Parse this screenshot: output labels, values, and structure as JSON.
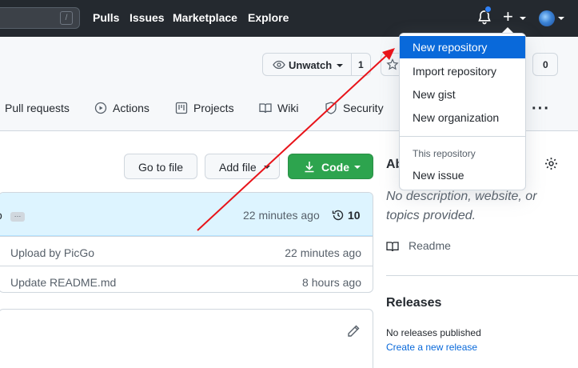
{
  "header": {
    "search_shortcut": "/",
    "nav": [
      "Pulls",
      "Issues",
      "Marketplace",
      "Explore"
    ],
    "plus_label": "+"
  },
  "repo": {
    "watch_label": "Unwatch",
    "watch_count": "1",
    "fork_count": "0",
    "tabs": [
      "Pull requests",
      "Actions",
      "Projects",
      "Wiki",
      "Security"
    ],
    "more_label": "···"
  },
  "code_area": {
    "go_to_file": "Go to file",
    "add_file": "Add file",
    "code": "Code",
    "commit_head": {
      "fragment": "o",
      "ellipsis": "…",
      "time": "22 minutes ago",
      "commit_count": "10"
    },
    "files": [
      {
        "message": "Upload by PicGo",
        "time": "22 minutes ago"
      },
      {
        "message": "Update README.md",
        "time": "8 hours ago"
      }
    ]
  },
  "sidebar": {
    "about_fragment": "Ab",
    "description": "No description, website, or topics provided.",
    "readme": "Readme",
    "releases_title": "Releases",
    "no_releases": "No releases published",
    "create_release": "Create a new release"
  },
  "dropdown": {
    "items": [
      "New repository",
      "Import repository",
      "New gist",
      "New organization"
    ],
    "section_header": "This repository",
    "section_items": [
      "New issue"
    ]
  },
  "colors": {
    "header_bg": "#24292f",
    "accent": "#0969da",
    "code_button": "#2da44e",
    "annotation_arrow": "#e8141a"
  }
}
